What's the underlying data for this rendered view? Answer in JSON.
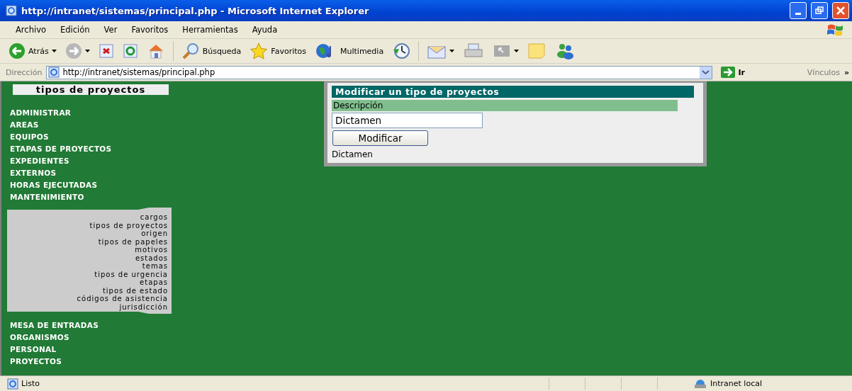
{
  "window": {
    "title": "http://intranet/sistemas/principal.php - Microsoft Internet Explorer"
  },
  "menu": [
    "Archivo",
    "Edición",
    "Ver",
    "Favoritos",
    "Herramientas",
    "Ayuda"
  ],
  "toolbar": [
    {
      "kind": "back",
      "label": "Atrás",
      "dropdown": true,
      "disabled": false
    },
    {
      "kind": "forward",
      "dropdown": true,
      "disabled": true
    },
    {
      "kind": "stop",
      "disabled": false
    },
    {
      "kind": "refresh",
      "disabled": false
    },
    {
      "kind": "home",
      "disabled": false
    },
    {
      "kind": "separator"
    },
    {
      "kind": "search",
      "label": "Búsqueda",
      "disabled": false
    },
    {
      "kind": "favorites",
      "label": "Favoritos",
      "disabled": false
    },
    {
      "kind": "media",
      "label": "Multimedia",
      "disabled": false
    },
    {
      "kind": "history",
      "disabled": false
    },
    {
      "kind": "separator"
    },
    {
      "kind": "mail",
      "dropdown": true,
      "disabled": false
    },
    {
      "kind": "print",
      "disabled": false
    },
    {
      "kind": "edit",
      "dropdown": true,
      "disabled": true
    },
    {
      "kind": "note",
      "disabled": false
    },
    {
      "kind": "messenger",
      "disabled": false
    }
  ],
  "address_bar": {
    "label": "Dirección",
    "url": "http://intranet/sistemas/principal.php",
    "go": "Ir",
    "links": "Vínculos",
    "more": "»"
  },
  "sidebar": {
    "heading": "tipos de proyectos",
    "items": [
      {
        "label": "ADMINISTRAR"
      },
      {
        "label": "AREAS"
      },
      {
        "label": "EQUIPOS"
      },
      {
        "label": "ETAPAS DE PROYECTOS"
      },
      {
        "label": "EXPEDIENTES"
      },
      {
        "label": "EXTERNOS"
      },
      {
        "label": "HORAS EJECUTADAS"
      },
      {
        "label": "MANTENIMIENTO",
        "children": [
          "cargos",
          "tipos de proyectos",
          "origen",
          "tipos de papeles",
          "motivos",
          "estados",
          "temas",
          "tipos de urgencia",
          "etapas",
          "tipos de estado",
          "códigos de asistencia",
          "jurisdicción"
        ]
      },
      {
        "label": "MESA DE ENTRADAS"
      },
      {
        "label": "ORGANISMOS"
      },
      {
        "label": "PERSONAL"
      },
      {
        "label": "PROYECTOS"
      }
    ]
  },
  "form": {
    "title": "Modificar un tipo de proyectos",
    "field_label": "Descripción",
    "value": "Dictamen",
    "button": "Modificar",
    "result": "Dictamen"
  },
  "status_bar": {
    "text": "Listo",
    "zone": "Intranet local"
  }
}
